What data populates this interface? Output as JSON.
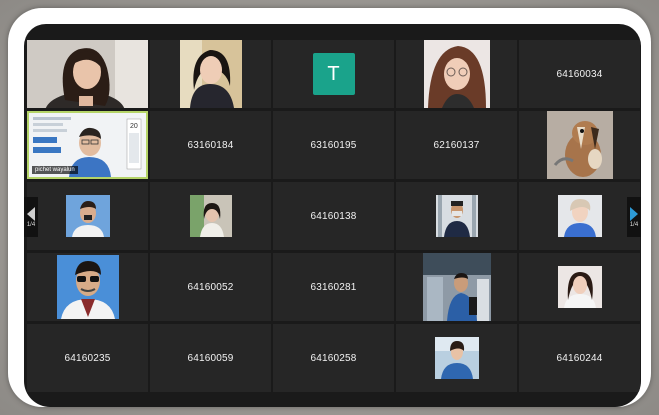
{
  "participants": [
    {
      "label": ""
    },
    {
      "label": ""
    },
    {
      "label": "T"
    },
    {
      "label": ""
    },
    {
      "label": "64160034"
    },
    {
      "label": "pichet wayalun"
    },
    {
      "label": "63160184"
    },
    {
      "label": "63160195"
    },
    {
      "label": "62160137"
    },
    {
      "label": ""
    },
    {
      "label": ""
    },
    {
      "label": ""
    },
    {
      "label": "64160138"
    },
    {
      "label": ""
    },
    {
      "label": ""
    },
    {
      "label": ""
    },
    {
      "label": "64160052"
    },
    {
      "label": "63160281"
    },
    {
      "label": ""
    },
    {
      "label": ""
    },
    {
      "label": "64160235"
    },
    {
      "label": "64160059"
    },
    {
      "label": "64160258"
    },
    {
      "label": ""
    },
    {
      "label": "64160244"
    }
  ],
  "nav": {
    "prev_page": "1/4",
    "next_page": "1/4"
  },
  "colors": {
    "tile_bg": "#262626",
    "active_border": "#b5d468",
    "avatar_t": "#1aa38b",
    "next_arrow": "#2d9ad6"
  }
}
